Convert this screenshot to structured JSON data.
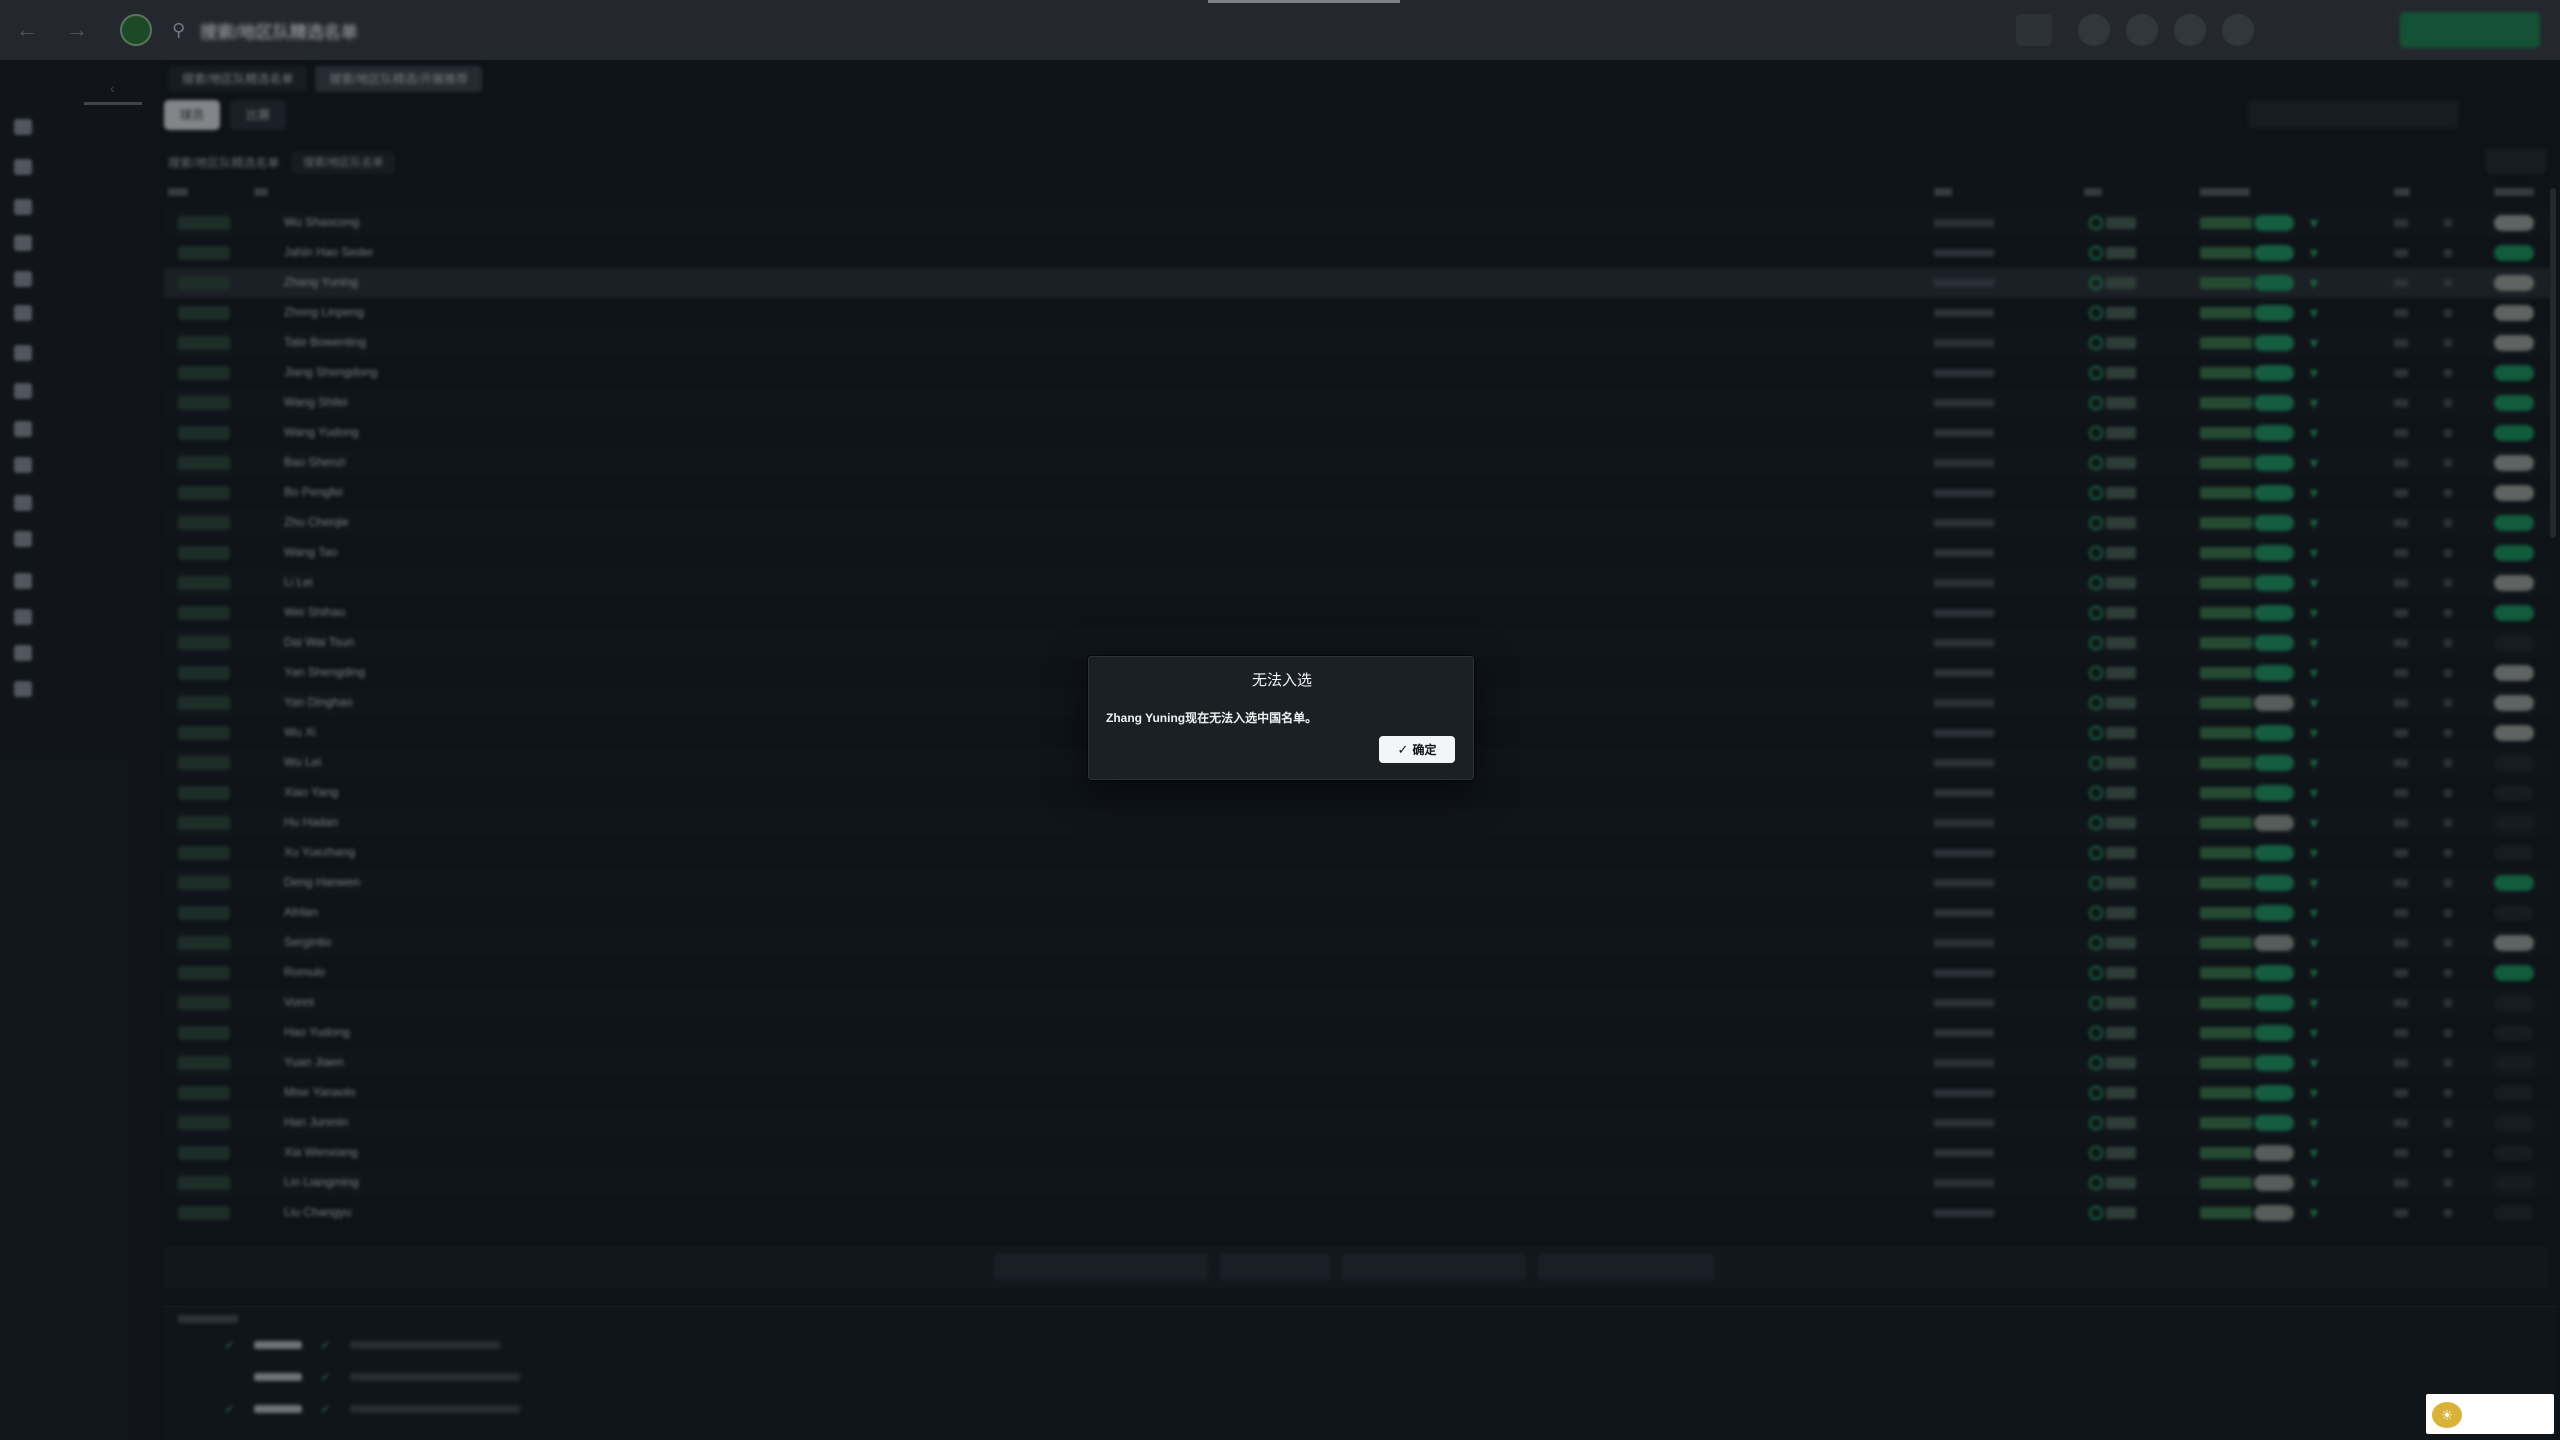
{
  "topbar": {
    "page_title": "搜索/地区队精选名单"
  },
  "tabs": [
    {
      "label": "搜索/地区队精选名单",
      "active": false
    },
    {
      "label": "搜索/地区队精选/开展推荐",
      "active": true
    }
  ],
  "toolbar": {
    "buttons": [
      "球员",
      "比赛"
    ]
  },
  "list": {
    "title": "搜索/地区队精选名单",
    "filter": "搜索/地区队名单"
  },
  "players": [
    {
      "name": "Wu Shaocong",
      "status_pill": "green",
      "toggle": "gray"
    },
    {
      "name": "Jahin Hao Seder",
      "status_pill": "green",
      "toggle": "on"
    },
    {
      "name": "Zhang Yuning",
      "status_pill": "green",
      "toggle": "gray",
      "selected": true
    },
    {
      "name": "Zhong Linpeng",
      "status_pill": "green",
      "toggle": "gray"
    },
    {
      "name": "Tate Bowenting",
      "status_pill": "green",
      "toggle": "gray"
    },
    {
      "name": "Jiang Shengdong",
      "status_pill": "green",
      "toggle": "on"
    },
    {
      "name": "Wang Shilei",
      "status_pill": "green",
      "toggle": "on"
    },
    {
      "name": "Wang Yudong",
      "status_pill": "green",
      "toggle": "on"
    },
    {
      "name": "Bao Shenzi",
      "status_pill": "green",
      "toggle": "gray"
    },
    {
      "name": "Bo Pengfei",
      "status_pill": "green",
      "toggle": "gray"
    },
    {
      "name": "Zhu Chenjie",
      "status_pill": "green",
      "toggle": "on"
    },
    {
      "name": "Wang Tao",
      "status_pill": "green",
      "toggle": "on"
    },
    {
      "name": "Li Lei",
      "status_pill": "green",
      "toggle": "gray"
    },
    {
      "name": "Wei Shihao",
      "status_pill": "green",
      "toggle": "on"
    },
    {
      "name": "Dai Wai Tsun",
      "status_pill": "green",
      "toggle": "off"
    },
    {
      "name": "Yan Shengding",
      "status_pill": "green",
      "toggle": "gray"
    },
    {
      "name": "Yan Dinghao",
      "status_pill": "gray",
      "toggle": "gray"
    },
    {
      "name": "Wu Xi",
      "status_pill": "green",
      "toggle": "gray"
    },
    {
      "name": "Wu Lei",
      "status_pill": "green",
      "toggle": "off"
    },
    {
      "name": "Xiao Yang",
      "status_pill": "green",
      "toggle": "off"
    },
    {
      "name": "Hu Hadan",
      "status_pill": "gray",
      "toggle": "off"
    },
    {
      "name": "Xu Yuezhang",
      "status_pill": "green",
      "toggle": "off"
    },
    {
      "name": "Deng Hanwen",
      "status_pill": "green",
      "toggle": "on"
    },
    {
      "name": "Afrilan",
      "status_pill": "green",
      "toggle": "off"
    },
    {
      "name": "Sergintio",
      "status_pill": "gray",
      "toggle": "gray"
    },
    {
      "name": "Romulo",
      "status_pill": "green",
      "toggle": "on"
    },
    {
      "name": "Vonni",
      "status_pill": "green",
      "toggle": "off"
    },
    {
      "name": "Hao Yudong",
      "status_pill": "green",
      "toggle": "off"
    },
    {
      "name": "Yuan Jiaen",
      "status_pill": "green",
      "toggle": "off"
    },
    {
      "name": "Mise Yanaolo",
      "status_pill": "green",
      "toggle": "off"
    },
    {
      "name": "Han Junmin",
      "status_pill": "green",
      "toggle": "off"
    },
    {
      "name": "Xia Wenxiang",
      "status_pill": "gray",
      "toggle": "off"
    },
    {
      "name": "Lin Liangming",
      "status_pill": "gray",
      "toggle": "off"
    },
    {
      "name": "Liu Changyu",
      "status_pill": "gray",
      "toggle": "off"
    }
  ],
  "dialog": {
    "title": "无法入选",
    "message": "Zhang Yuning现在无法入选中国名单。",
    "ok_label": "确定"
  },
  "colors": {
    "accent_green": "#1fa06a",
    "dialog_bg": "#1b2025",
    "topbar_bg": "#3b4148"
  },
  "icons": {
    "back": "arrow-left-icon",
    "forward": "arrow-right-icon",
    "search": "search-icon",
    "ok": "check-icon"
  }
}
